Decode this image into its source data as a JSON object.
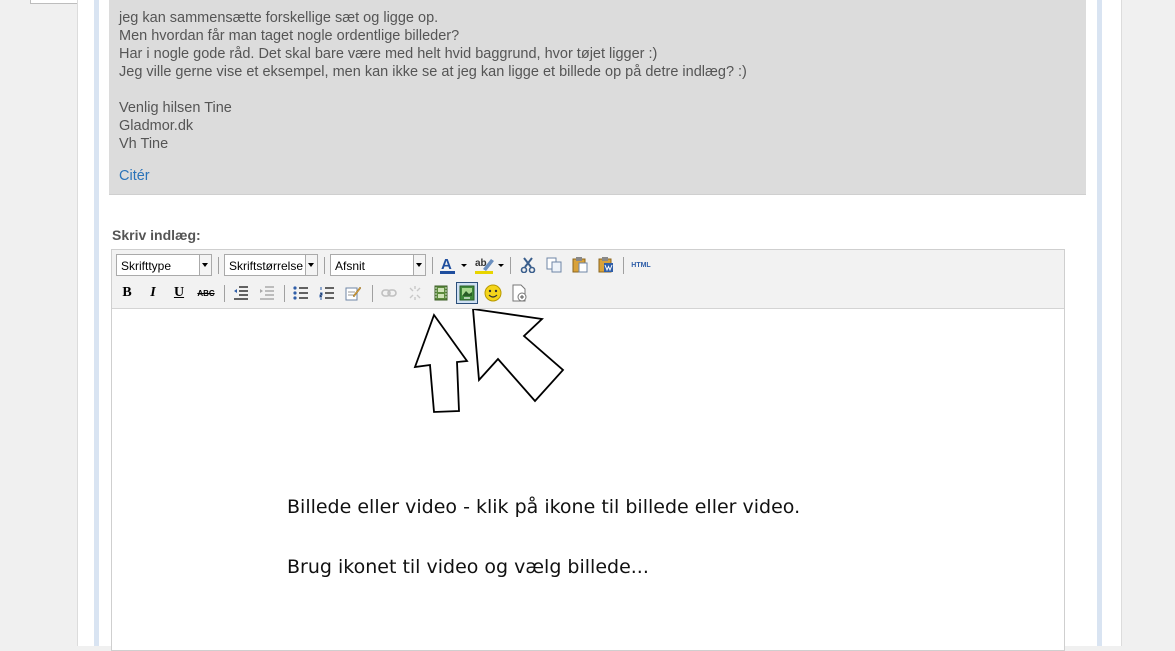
{
  "quote": {
    "lines": [
      "jeg kan sammensætte forskellige sæt og ligge op.",
      "Men hvordan får man taget nogle ordentlige billeder?",
      "Har i nogle gode råd. Det skal bare være med helt hvid baggrund, hvor tøjet ligger :)",
      "Jeg ville gerne vise et eksempel, men kan ikke se at jeg kan ligge et billede op på detre indlæg? :)",
      "",
      "Venlig hilsen Tine",
      "Gladmor.dk",
      "Vh Tine"
    ],
    "cite_label": "Citér"
  },
  "editor": {
    "label": "Skriv indlæg:",
    "font_select": "Skrifttype",
    "size_select": "Skriftstørrelse",
    "format_select": "Afsnit",
    "html_label": "HTML",
    "bold_label": "B",
    "italic_label": "I",
    "underline_label": "U",
    "strike_label": "ABC",
    "text_color_label": "A",
    "highlight_label": "ab",
    "content_lines": [
      "Billede eller video - klik på ikone til billede eller video.",
      "Brug ikonet til video og vælg billede..."
    ]
  },
  "colors": {
    "quote_bg": "#dcdcdc",
    "link": "#2a73b9",
    "text_color_underline": "#1f4e9e",
    "highlight_underline": "#e8d500"
  }
}
